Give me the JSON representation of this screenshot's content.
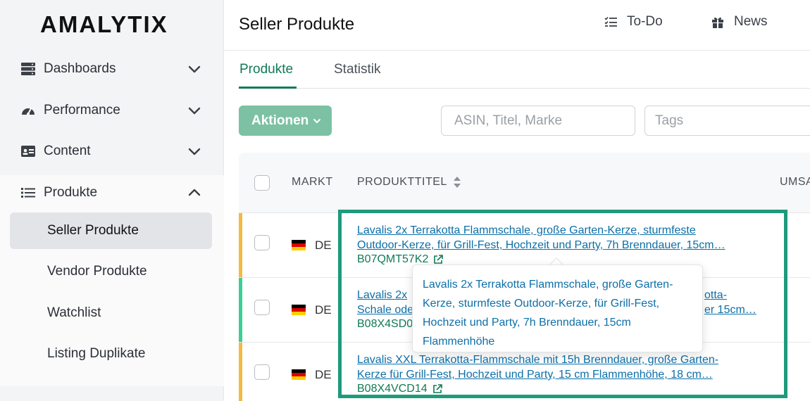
{
  "brand": {
    "logo_text": "AMALYTIX"
  },
  "sidebar": {
    "groups": [
      {
        "label": "Dashboards",
        "icon": "server-stack-icon"
      },
      {
        "label": "Performance",
        "icon": "gauge-icon"
      },
      {
        "label": "Content",
        "icon": "id-card-icon"
      },
      {
        "label": "Produkte",
        "icon": "list-icon"
      }
    ],
    "sub_items": [
      {
        "label": "Seller Produkte",
        "active": true
      },
      {
        "label": "Vendor Produkte"
      },
      {
        "label": "Watchlist"
      },
      {
        "label": "Listing Duplikate"
      }
    ]
  },
  "header": {
    "title": "Seller Produkte",
    "todo_label": "To-Do",
    "news_label": "News"
  },
  "tabs": [
    {
      "label": "Produkte",
      "active": true
    },
    {
      "label": "Statistik"
    }
  ],
  "toolbar": {
    "actions_label": "Aktionen",
    "search_placeholder": "ASIN, Titel, Marke",
    "tags_placeholder": "Tags"
  },
  "table": {
    "columns": {
      "market": "MARKT",
      "title": "PRODUKTTITEL",
      "revenue": "UMSA"
    },
    "rows": [
      {
        "stripe_color": "#f5b942",
        "market": "DE",
        "title_line1": "Lavalis 2x Terrakotta Flammschale, große Garten-Kerze, sturmfeste",
        "title_line2": "Outdoor-Kerze, für Grill-Fest, Hochzeit und Party, 7h Brenndauer, 15cm…",
        "asin": "B07QMT57K2"
      },
      {
        "stripe_color": "#3ccf95",
        "market": "DE",
        "title_line1": "Lavalis 2x",
        "title_line1_tail": "otta-",
        "title_line2": "Schale ode",
        "title_line2_tail": "er 15cm…",
        "asin": "B08X4SD0"
      },
      {
        "stripe_color": "#f5b942",
        "market": "DE",
        "title_line1": "Lavalis XXL Terrakotta-Flammschale mit 15h Brenndauer, große Garten-",
        "title_line2": "Kerze für Grill-Fest, Hochzeit und Party, 15 cm Flammenhöhe, 18 cm…",
        "asin": "B08X4VCD14"
      }
    ]
  },
  "tooltip": {
    "text": "Lavalis 2x Terrakotta Flammschale, große Garten-Kerze, sturmfeste Outdoor-Kerze, für Grill-Fest, Hochzeit und Party, 7h Brenndauer, 15cm Flammenhöhe"
  },
  "colors": {
    "accent": "#117a55",
    "highlight_box": "#1e9a7d",
    "link": "#0c6fa8"
  }
}
